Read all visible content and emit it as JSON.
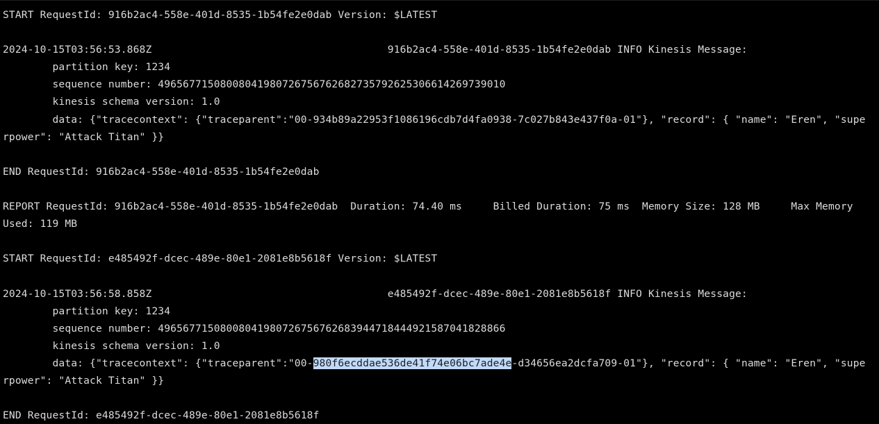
{
  "terminal": {
    "name": "aws-lambda-cloudwatch-log-output",
    "background_color": "#000000",
    "foreground_color": "#dcdcdc",
    "selection_background_color": "#c3daf7",
    "selection_foreground_color": "#17202b",
    "lines": [
      {
        "id": "line-1",
        "text": "START RequestId: 916b2ac4-558e-401d-8535-1b54fe2e0dab Version: $LATEST"
      },
      {
        "id": "line-2",
        "text": ""
      },
      {
        "id": "line-3",
        "text": "2024-10-15T03:56:53.868Z\t916b2ac4-558e-401d-8535-1b54fe2e0dab\tINFO\tKinesis Message:"
      },
      {
        "id": "line-4",
        "text": "        partition key: 1234"
      },
      {
        "id": "line-5",
        "text": "        sequence number: 49656771508008041980726756762682735792625306614269739010"
      },
      {
        "id": "line-6",
        "text": "        kinesis schema version: 1.0"
      },
      {
        "id": "line-7",
        "text": "        data: {\"tracecontext\": {\"traceparent\":\"00-934b89a22953f1086196cdb7d4fa0938-7c027b843e437f0a-01\"}, \"record\": { \"name\": \"Eren\", \"supe"
      },
      {
        "id": "line-8",
        "text": "rpower\": \"Attack Titan\" }}"
      },
      {
        "id": "line-9",
        "text": ""
      },
      {
        "id": "line-10",
        "text": "END RequestId: 916b2ac4-558e-401d-8535-1b54fe2e0dab"
      },
      {
        "id": "line-11",
        "text": ""
      },
      {
        "id": "line-12",
        "text": "REPORT RequestId: 916b2ac4-558e-401d-8535-1b54fe2e0dab  Duration: 74.40 ms     Billed Duration: 75 ms  Memory Size: 128 MB     Max Memory"
      },
      {
        "id": "line-13",
        "text": "Used: 119 MB"
      },
      {
        "id": "line-14",
        "text": ""
      },
      {
        "id": "line-15",
        "text": "START RequestId: e485492f-dcec-489e-80e1-2081e8b5618f Version: $LATEST"
      },
      {
        "id": "line-16",
        "text": ""
      },
      {
        "id": "line-17",
        "text": "2024-10-15T03:56:58.858Z\te485492f-dcec-489e-80e1-2081e8b5618f\tINFO\tKinesis Message:"
      },
      {
        "id": "line-18",
        "text": "        partition key: 1234"
      },
      {
        "id": "line-19",
        "text": "        sequence number: 49656771508008041980726756762683944718444921587041828866"
      },
      {
        "id": "line-20",
        "text": "        kinesis schema version: 1.0"
      },
      {
        "id": "line-21",
        "segments": [
          {
            "text": "        data: {\"tracecontext\": {\"traceparent\":\"00-",
            "highlighted": false
          },
          {
            "text": "980f6ecddae536de41f74e06bc7ade4e",
            "highlighted": true
          },
          {
            "text": "-d34656ea2dcfa709-01\"}, \"record\": { \"name\": \"Eren\", \"supe",
            "highlighted": false
          }
        ]
      },
      {
        "id": "line-22",
        "text": "rpower\": \"Attack Titan\" }}"
      },
      {
        "id": "line-23",
        "text": ""
      },
      {
        "id": "line-24",
        "text": "END RequestId: e485492f-dcec-489e-80e1-2081e8b5618f"
      }
    ],
    "selected_text": "980f6ecddae536de41f74e06bc7ade4e",
    "log_details": {
      "invocations": [
        {
          "request_id": "916b2ac4-558e-401d-8535-1b54fe2e0dab",
          "version": "$LATEST",
          "timestamp": "2024-10-15T03:56:53.868Z",
          "level": "INFO",
          "message_label": "Kinesis Message:",
          "partition_key": "1234",
          "sequence_number": "49656771508008041980726756762682735792625306614269739010",
          "kinesis_schema_version": "1.0",
          "traceparent": "00-934b89a22953f1086196cdb7d4fa0938-7c027b843e437f0a-01",
          "record_name": "Eren",
          "record_superpower": "Attack Titan",
          "duration": "74.40 ms",
          "billed_duration": "75 ms",
          "memory_size": "128 MB",
          "max_memory_used": "119 MB"
        },
        {
          "request_id": "e485492f-dcec-489e-80e1-2081e8b5618f",
          "version": "$LATEST",
          "timestamp": "2024-10-15T03:56:58.858Z",
          "level": "INFO",
          "message_label": "Kinesis Message:",
          "partition_key": "1234",
          "sequence_number": "49656771508008041980726756762683944718444921587041828866",
          "kinesis_schema_version": "1.0",
          "traceparent": "00-980f6ecddae536de41f74e06bc7ade4e-d34656ea2dcfa709-01",
          "trace_id": "980f6ecddae536de41f74e06bc7ade4e",
          "span_id": "d34656ea2dcfa709",
          "record_name": "Eren",
          "record_superpower": "Attack Titan"
        }
      ]
    }
  }
}
